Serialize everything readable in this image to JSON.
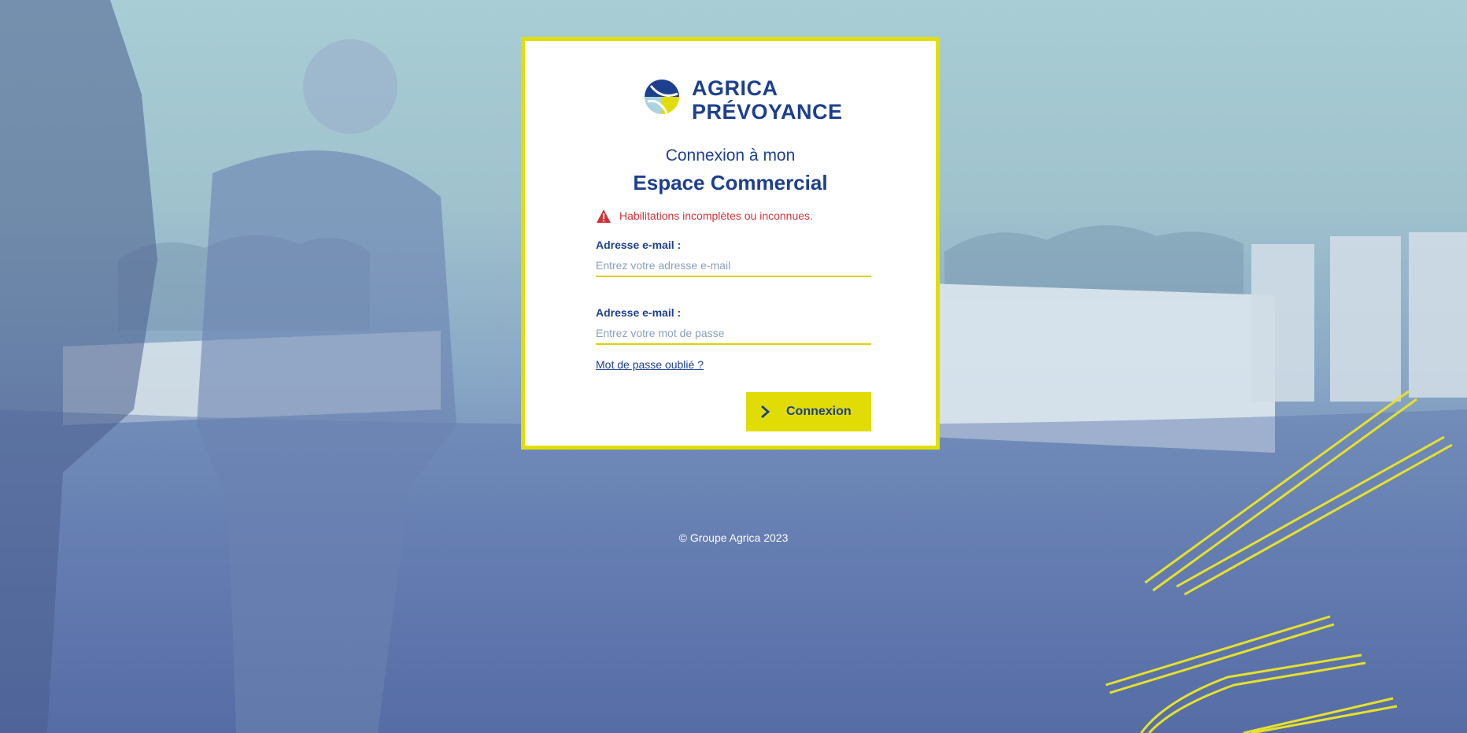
{
  "brand": {
    "line1": "AGRICA",
    "line2": "PRÉVOYANCE",
    "color_primary": "#1d3f8f",
    "color_accent": "#e1dc05"
  },
  "login": {
    "title_line1": "Connexion à mon",
    "title_line2": "Espace Commercial",
    "error_message": "Habilitations incomplètes ou inconnues.",
    "error_icon": "warning-triangle-icon",
    "email_label": "Adresse e-mail :",
    "email_placeholder": "Entrez votre adresse e-mail",
    "password_label": "Adresse e-mail :",
    "password_placeholder": "Entrez votre mot de passe",
    "forgot_link": "Mot de passe oublié ?",
    "submit_label": "Connexion",
    "submit_icon": "chevron-right-icon"
  },
  "footer": {
    "copyright": "© Groupe Agrica 2023"
  }
}
